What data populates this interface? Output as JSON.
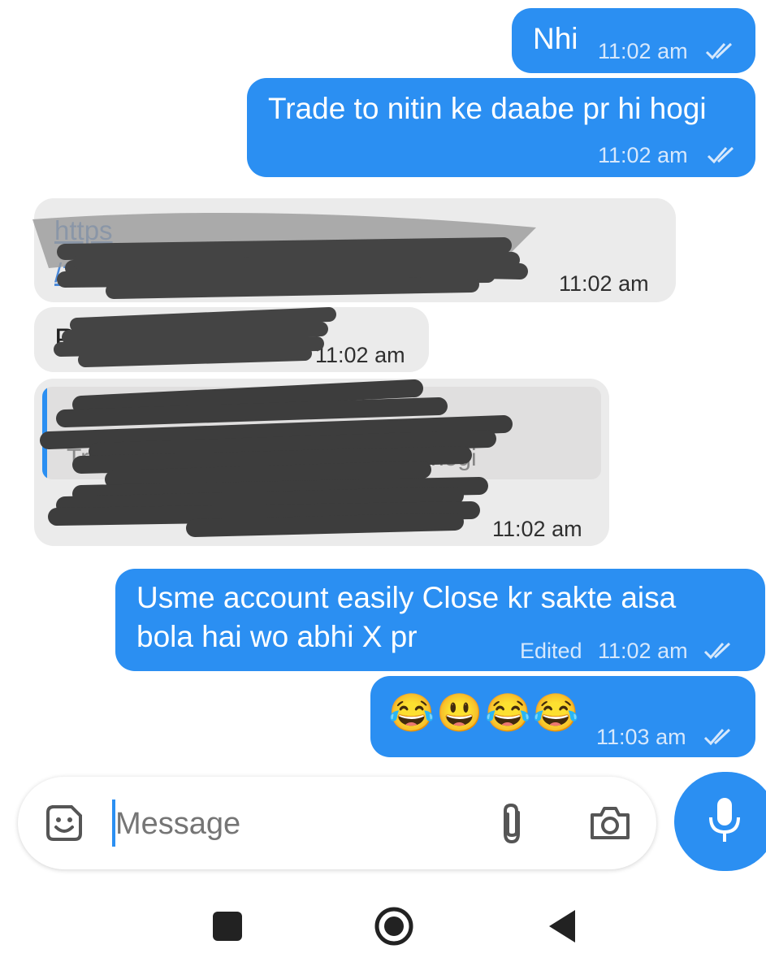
{
  "messages": [
    {
      "direction": "out",
      "text": "Nhi",
      "time": "11:02 am"
    },
    {
      "direction": "out",
      "text": "Trade to nitin ke daabe pr hi hogi",
      "time": "11:02 am"
    },
    {
      "direction": "in",
      "link_visible": "https",
      "link_line2": "/2",
      "time": "11:02 am"
    },
    {
      "direction": "in",
      "text": "R",
      "time": "11:02 am"
    },
    {
      "direction": "in",
      "reply_preview": "Tr",
      "reply_tail": "hogi",
      "text": "",
      "time": "11:02 am"
    },
    {
      "direction": "out",
      "text_line1": "Usme account easily Close kr sakte aisa",
      "text_line2": "bola hai wo abhi X pr",
      "edited": "Edited",
      "time": "11:02 am"
    },
    {
      "direction": "out",
      "emojis": "😂😃😂😂",
      "time": "11:03 am"
    }
  ],
  "composer": {
    "placeholder": "Message"
  },
  "icons": [
    "sticker-icon",
    "attach-icon",
    "camera-icon",
    "mic-icon",
    "nav-square-icon",
    "nav-home-icon",
    "nav-back-icon"
  ],
  "colors": {
    "outgoing": "#2b8ff2",
    "incoming": "#ebebeb",
    "accent": "#2b8ff2"
  }
}
